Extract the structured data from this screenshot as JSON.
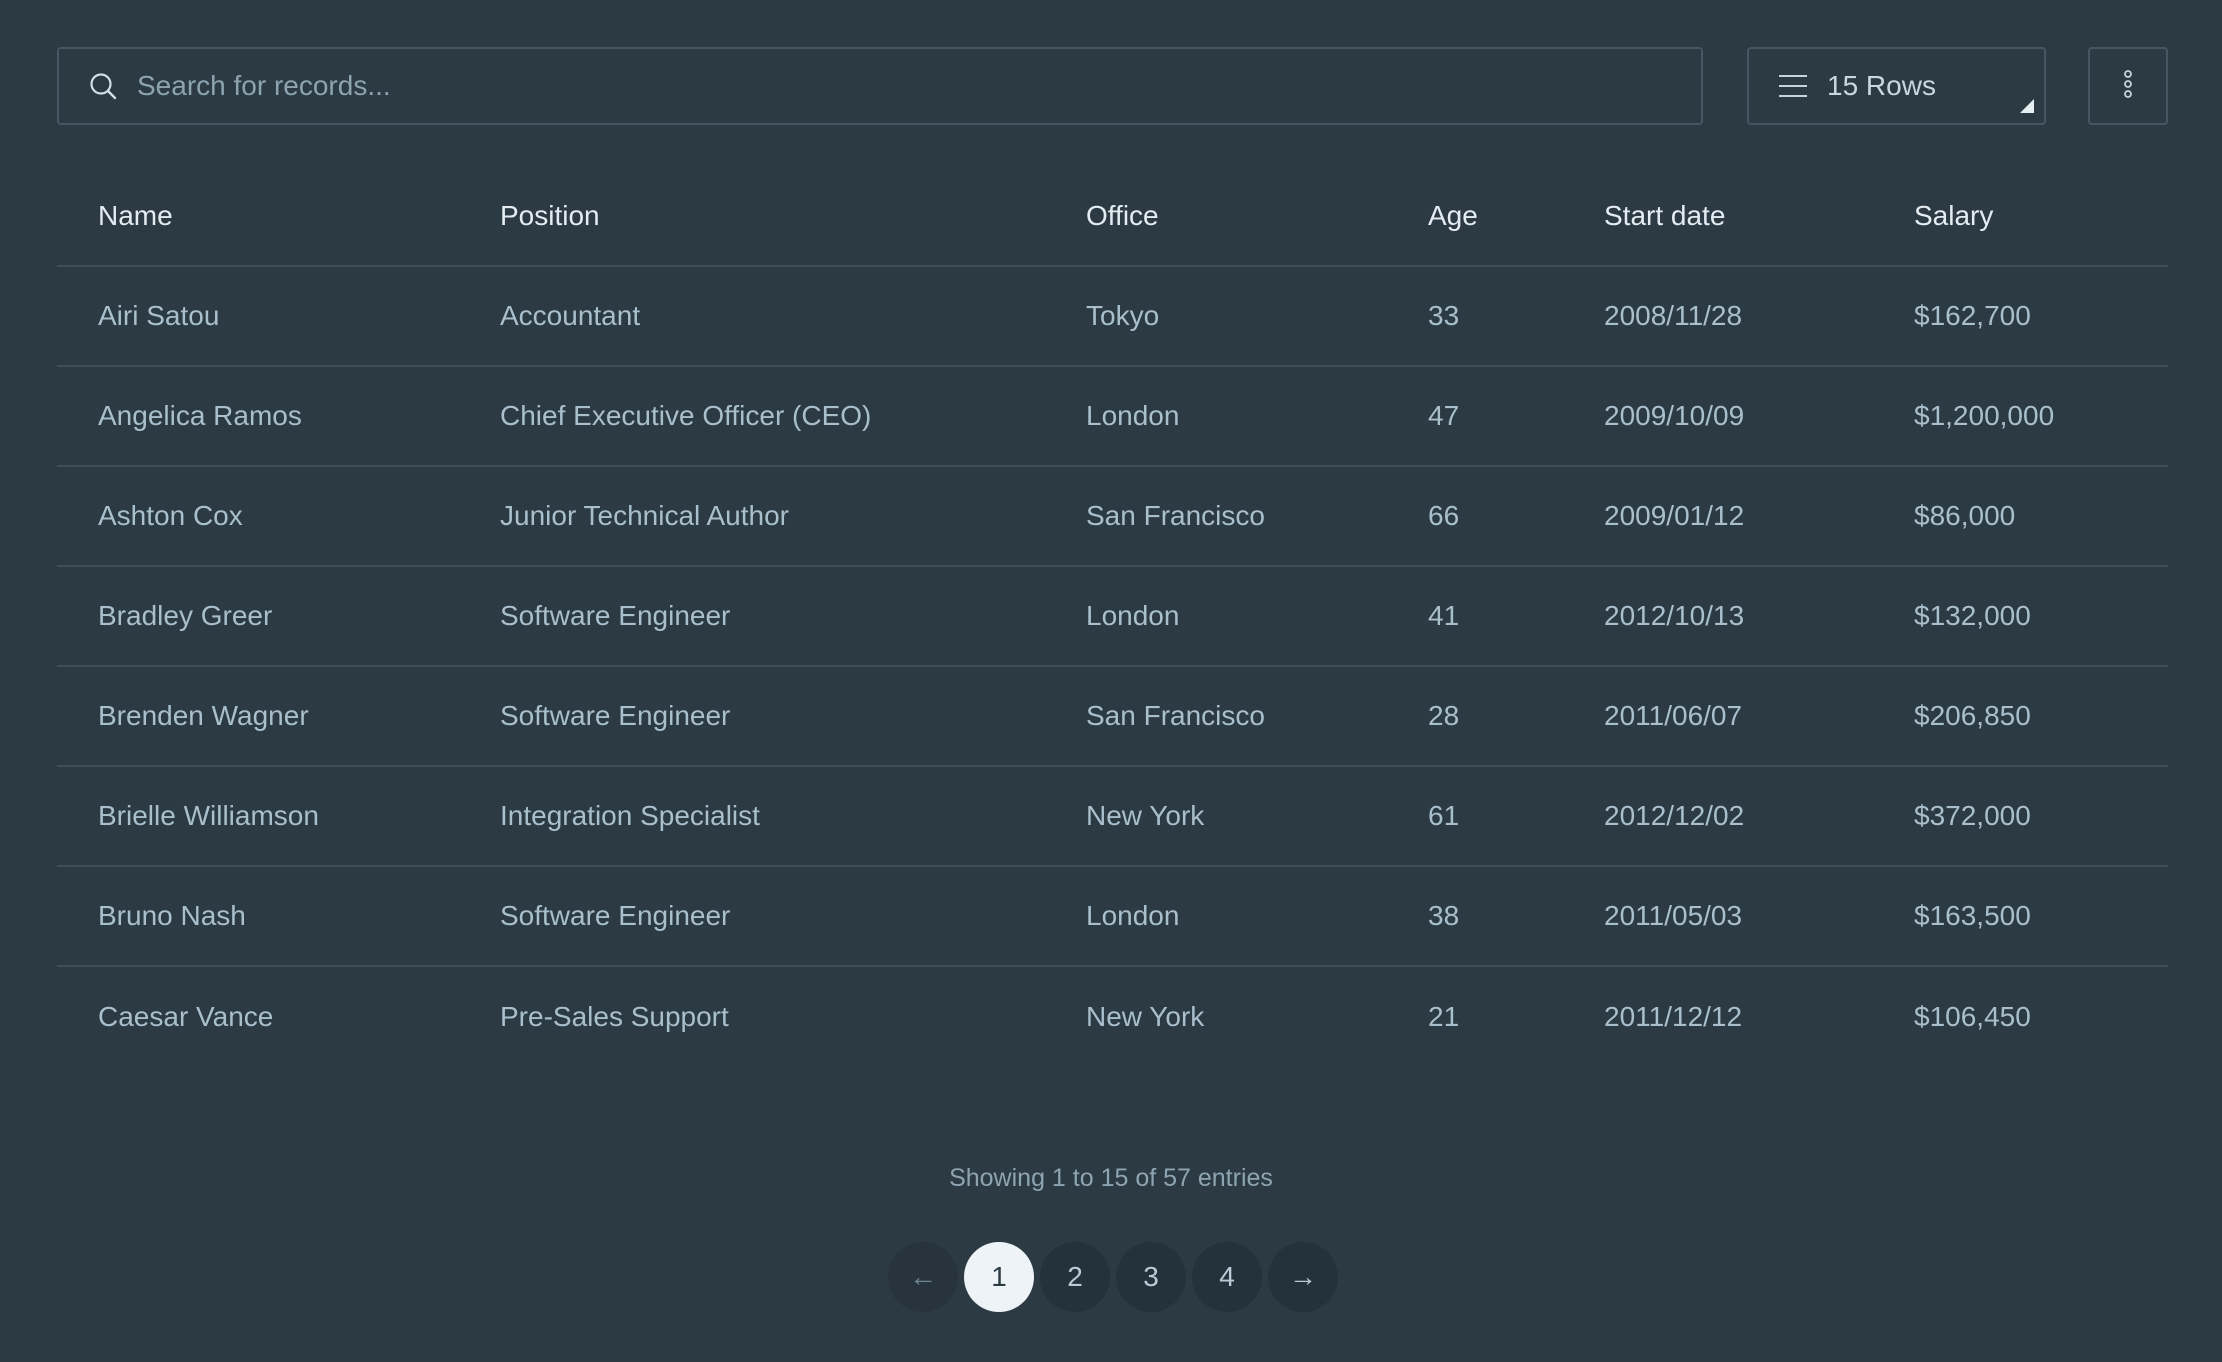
{
  "toolbar": {
    "search_placeholder": "Search for records...",
    "rows_label": "15 Rows"
  },
  "table": {
    "headers": [
      "Name",
      "Position",
      "Office",
      "Age",
      "Start date",
      "Salary"
    ],
    "rows": [
      [
        "Airi Satou",
        "Accountant",
        "Tokyo",
        "33",
        "2008/11/28",
        "$162,700"
      ],
      [
        "Angelica Ramos",
        "Chief Executive Officer (CEO)",
        "London",
        "47",
        "2009/10/09",
        "$1,200,000"
      ],
      [
        "Ashton Cox",
        "Junior Technical Author",
        "San Francisco",
        "66",
        "2009/01/12",
        "$86,000"
      ],
      [
        "Bradley Greer",
        "Software Engineer",
        "London",
        "41",
        "2012/10/13",
        "$132,000"
      ],
      [
        "Brenden Wagner",
        "Software Engineer",
        "San Francisco",
        "28",
        "2011/06/07",
        "$206,850"
      ],
      [
        "Brielle Williamson",
        "Integration Specialist",
        "New York",
        "61",
        "2012/12/02",
        "$372,000"
      ],
      [
        "Bruno Nash",
        "Software Engineer",
        "London",
        "38",
        "2011/05/03",
        "$163,500"
      ],
      [
        "Caesar Vance",
        "Pre-Sales Support",
        "New York",
        "21",
        "2011/12/12",
        "$106,450"
      ]
    ]
  },
  "footer": {
    "status": "Showing 1 to 15 of 57 entries",
    "prev_label": "←",
    "next_label": "→",
    "pages": [
      "1",
      "2",
      "3",
      "4"
    ],
    "active_page": "1"
  },
  "icons": {
    "search": "search-icon",
    "rows": "menu-lines-icon",
    "more": "more-vertical-icon",
    "prev": "arrow-left-icon",
    "next": "arrow-right-icon"
  }
}
